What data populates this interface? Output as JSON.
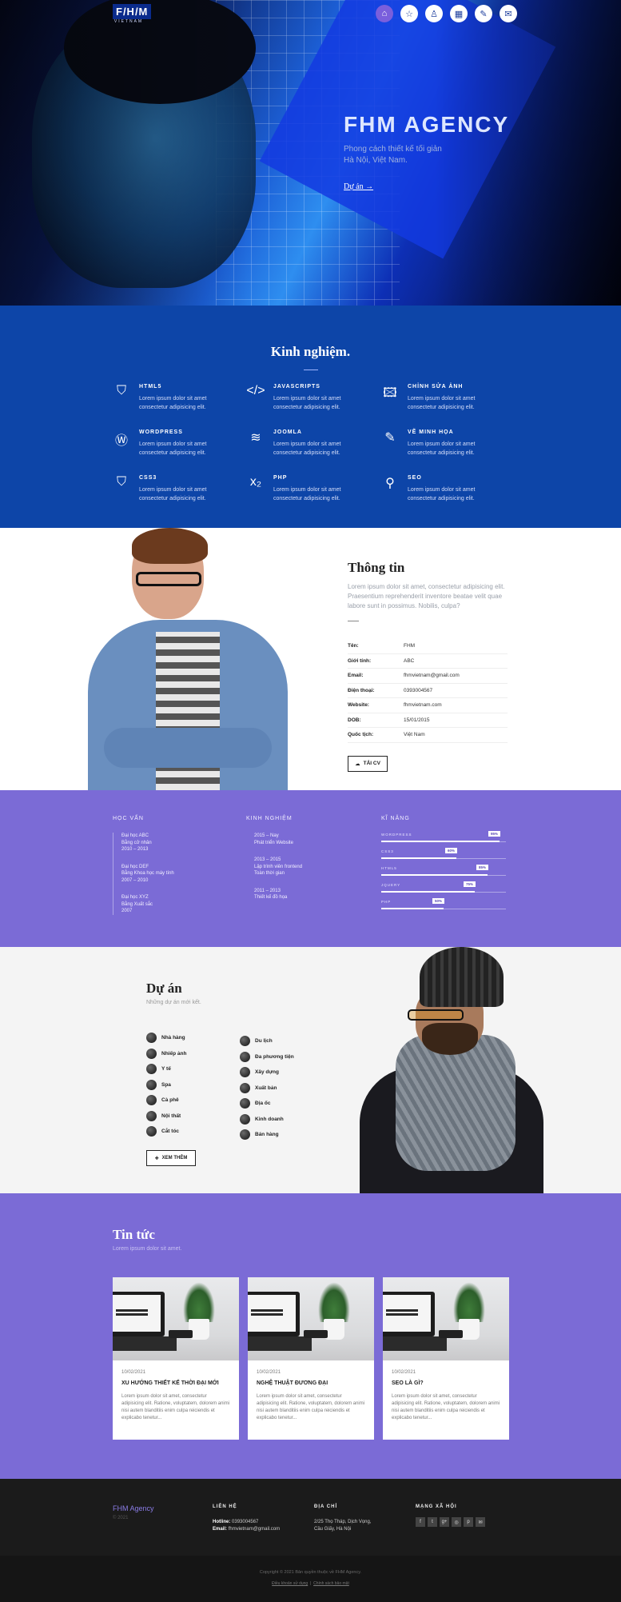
{
  "brand": {
    "logo_text": "F/H/M",
    "logo_sub": "VIETNAM"
  },
  "nav": [
    {
      "icon": "home-icon",
      "glyph": "⌂"
    },
    {
      "icon": "star-icon",
      "glyph": "☆"
    },
    {
      "icon": "user-icon",
      "glyph": "♙"
    },
    {
      "icon": "grid-icon",
      "glyph": "▦"
    },
    {
      "icon": "pen-icon",
      "glyph": "✎"
    },
    {
      "icon": "mail-icon",
      "glyph": "✉"
    }
  ],
  "hero": {
    "title": "FHM AGENCY",
    "line1": "Phong cách thiết kế tối giản",
    "line2": "Hà Nội, Việt Nam.",
    "link": "Dự án →"
  },
  "experience": {
    "title": "Kinh nghiệm.",
    "items": [
      {
        "icon": "html5-icon",
        "glyph": "⛉",
        "name": "HTML5",
        "desc": "Lorem ipsum dolor sit amet consectetur adipisicing elit."
      },
      {
        "icon": "code-icon",
        "glyph": "</>",
        "name": "JAVASCRIPTS",
        "desc": "Lorem ipsum dolor sit amet consectetur adipisicing elit."
      },
      {
        "icon": "image-icon",
        "glyph": "🖾",
        "name": "CHỈNH SỬA ẢNH",
        "desc": "Lorem ipsum dolor sit amet consectetur adipisicing elit."
      },
      {
        "icon": "wordpress-icon",
        "glyph": "Ⓦ",
        "name": "WORDPRESS",
        "desc": "Lorem ipsum dolor sit amet consectetur adipisicing elit."
      },
      {
        "icon": "layers-icon",
        "glyph": "≋",
        "name": "JOOMLA",
        "desc": "Lorem ipsum dolor sit amet consectetur adipisicing elit."
      },
      {
        "icon": "pencil-icon",
        "glyph": "✎",
        "name": "VẼ MINH HỌA",
        "desc": "Lorem ipsum dolor sit amet consectetur adipisicing elit."
      },
      {
        "icon": "css3-icon",
        "glyph": "⛉",
        "name": "CSS3",
        "desc": "Lorem ipsum dolor sit amet consectetur adipisicing elit."
      },
      {
        "icon": "superscript-icon",
        "glyph": "x₂",
        "name": "PHP",
        "desc": "Lorem ipsum dolor sit amet consectetur adipisicing elit."
      },
      {
        "icon": "search-icon",
        "glyph": "⚲",
        "name": "SEO",
        "desc": "Lorem ipsum dolor sit amet consectetur adipisicing elit."
      }
    ]
  },
  "info": {
    "title": "Thông tin",
    "lead": "Lorem ipsum dolor sit amet, consectetur adipisicing elit. Praesentium reprehenderit inventore beatae velit quae labore sunt in possimus. Nobilis, culpa?",
    "rows": [
      {
        "k": "Tên:",
        "v": "FHM"
      },
      {
        "k": "Giới tính:",
        "v": "ABC"
      },
      {
        "k": "Email:",
        "v": "fhmvietnam@gmail.com"
      },
      {
        "k": "Điện thoại:",
        "v": "0393004567"
      },
      {
        "k": "Website:",
        "v": "fhmvietnam.com"
      },
      {
        "k": "DOB:",
        "v": "15/01/2015"
      },
      {
        "k": "Quốc tịch:",
        "v": "Việt Nam"
      }
    ],
    "cv_button": "TẢI CV"
  },
  "resume": {
    "edu_title": "HỌC VẤN",
    "edu": [
      [
        "Đại học ABC",
        "Bằng cử nhân",
        "2010 – 2013"
      ],
      [
        "Đại học DEF",
        "Bằng Khoa học máy tính",
        "2007 – 2010"
      ],
      [
        "Đại học XYZ",
        "Bằng Xuất sắc",
        "2007"
      ]
    ],
    "work_title": "KINH NGHIỆM",
    "work": [
      [
        "2015 – Nay",
        "Phát triển Website"
      ],
      [
        "2013 – 2015",
        "Lập trình viên frontend",
        "Toàn thời gian"
      ],
      [
        "2011 – 2013",
        "Thiết kế đồ họa"
      ]
    ],
    "skills_title": "KĨ NĂNG",
    "skills": [
      {
        "name": "WORDPRESS",
        "pct": 95,
        "label": "95%"
      },
      {
        "name": "CSS3",
        "pct": 60,
        "label": "60%"
      },
      {
        "name": "HTML5",
        "pct": 85,
        "label": "85%"
      },
      {
        "name": "JQUERY",
        "pct": 75,
        "label": "75%"
      },
      {
        "name": "PHP",
        "pct": 50,
        "label": "50%"
      }
    ]
  },
  "projects": {
    "title": "Dự án",
    "subtitle": "Những dự án mới kết.",
    "left": [
      "Nhà hàng",
      "Nhiếp ảnh",
      "Y tế",
      "Spa",
      "Cà phê",
      "Nội thất",
      "Cắt tóc"
    ],
    "right": [
      "Du lịch",
      "Đa phương tiện",
      "Xây dựng",
      "Xuất bản",
      "Địa ốc",
      "Kinh doanh",
      "Bán hàng"
    ],
    "more_button": "XEM THÊM"
  },
  "news": {
    "title": "Tin tức",
    "subtitle": "Lorem ipsum dolor sit amet.",
    "cards": [
      {
        "date": "10/02/2021",
        "title": "XU HƯỚNG THIẾT KẾ THỜI ĐẠI MỚI",
        "excerpt": "Lorem ipsum dolor sit amet, consectetur adipisicing elit. Ratione, voluptatem, dolorem animi nisi autem blanditiis enim culpa reiciendis et explicabo tenetur..."
      },
      {
        "date": "10/02/2021",
        "title": "NGHỆ THUẬT ĐƯƠNG ĐẠI",
        "excerpt": "Lorem ipsum dolor sit amet, consectetur adipisicing elit. Ratione, voluptatem, dolorem animi nisi autem blanditiis enim culpa reiciendis et explicabo tenetur..."
      },
      {
        "date": "10/02/2021",
        "title": "SEO LÀ GÌ?",
        "excerpt": "Lorem ipsum dolor sit amet, consectetur adipisicing elit. Ratione, voluptatem, dolorem animi nisi autem blanditiis enim culpa reiciendis et explicabo tenetur..."
      }
    ]
  },
  "footer": {
    "brand": "FHM Agency",
    "year": "© 2021",
    "contact_title": "LIÊN HỆ",
    "hotline_label": "Hotline:",
    "hotline": "0393004567",
    "email_label": "Email:",
    "email": "fhmvietnam@gmail.com",
    "address_title": "ĐỊA CHỈ",
    "address1": "2/25 Thọ Tháp, Dịch Vọng,",
    "address2": "Cầu Giấy, Hà Nội",
    "social_title": "MẠNG XÃ HỘI",
    "socials": [
      {
        "icon": "facebook-icon",
        "glyph": "f"
      },
      {
        "icon": "twitter-icon",
        "glyph": "t"
      },
      {
        "icon": "google-plus-icon",
        "glyph": "g+"
      },
      {
        "icon": "instagram-icon",
        "glyph": "◎"
      },
      {
        "icon": "pinterest-icon",
        "glyph": "p"
      },
      {
        "icon": "email-icon",
        "glyph": "✉"
      }
    ],
    "copyright": "Copyright © 2021 Bản quyền thuộc về FHM Agency.",
    "link1": "Điều khoản sử dụng",
    "link2": "Chính sách bảo mật"
  }
}
